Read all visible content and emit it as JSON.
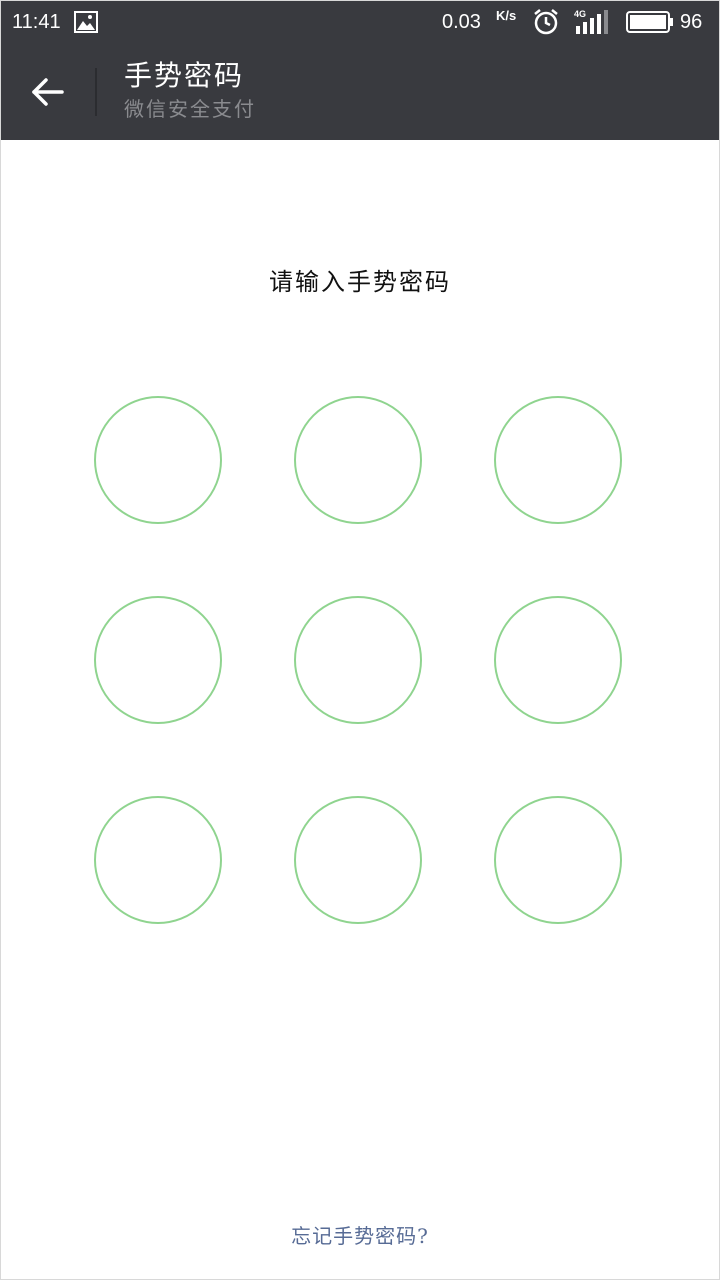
{
  "status_bar": {
    "time": "11:41",
    "network_speed": "0.03",
    "speed_unit": "K/s",
    "network_type": "4G",
    "battery_level": "96",
    "background_color": "#393a3f"
  },
  "header": {
    "title": "手势密码",
    "subtitle": "微信安全支付",
    "background_color": "#393a3f"
  },
  "main": {
    "prompt": "请输入手势密码",
    "pattern_node_color": "#8fd48f",
    "pattern_nodes": [
      1,
      2,
      3,
      4,
      5,
      6,
      7,
      8,
      9
    ]
  },
  "footer": {
    "forgot_link": "忘记手势密码?",
    "link_color": "#576b95"
  },
  "icons": {
    "back": "arrow-left-icon",
    "gallery": "image-icon",
    "alarm": "alarm-clock-icon",
    "signal": "signal-bars-icon",
    "battery": "battery-icon"
  }
}
